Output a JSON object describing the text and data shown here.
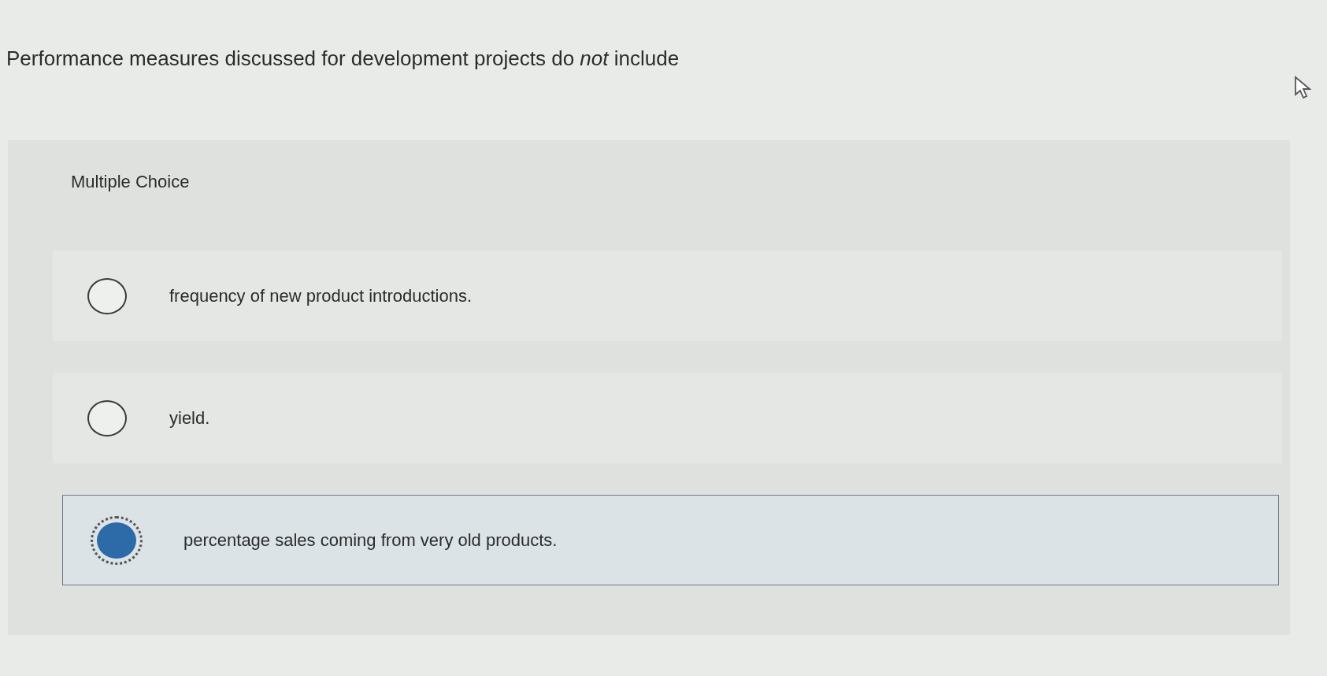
{
  "question": "Performance measures discussed for development projects do *not* include",
  "question_type": "Multiple Choice",
  "options": [
    {
      "label": "frequency of new product introductions.",
      "selected": false
    },
    {
      "label": "yield.",
      "selected": false
    },
    {
      "label": "percentage sales coming from very old products.",
      "selected": true
    }
  ]
}
